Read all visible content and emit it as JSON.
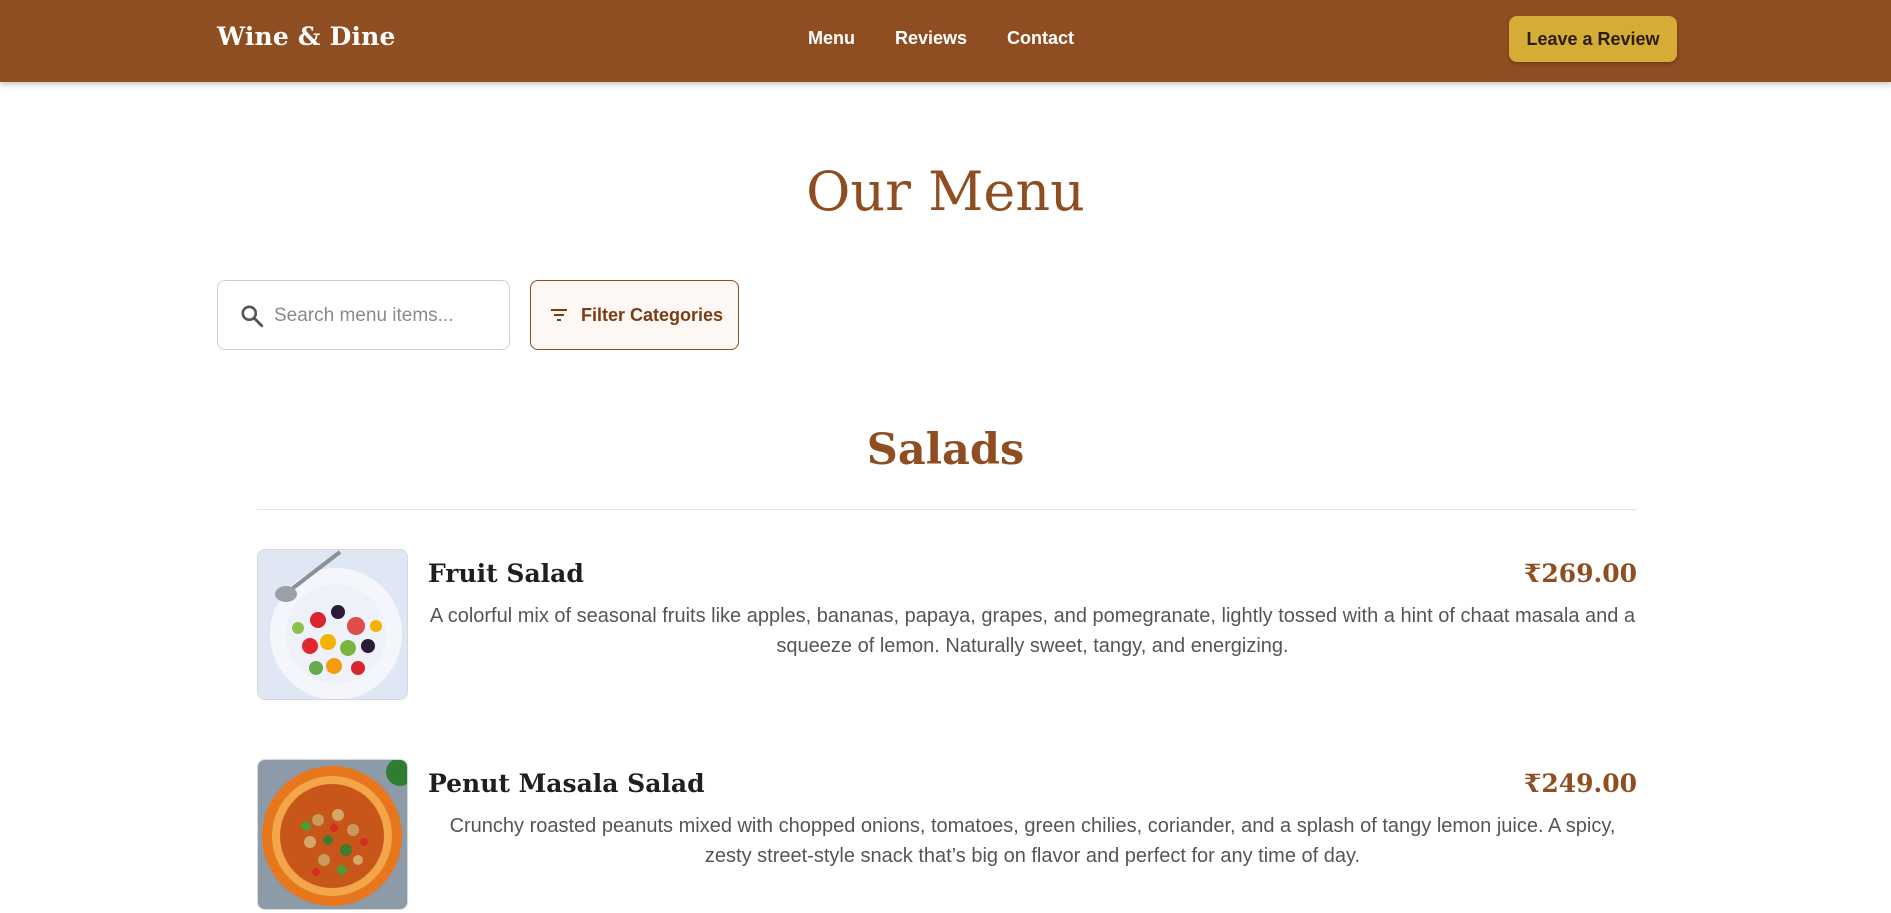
{
  "nav": {
    "brand": "Wine & Dine",
    "links": [
      "Menu",
      "Reviews",
      "Contact"
    ],
    "cta_label": "Leave a Review"
  },
  "main": {
    "title": "Our Menu",
    "search": {
      "placeholder": "Search menu items..."
    },
    "filter_label": "Filter Categories",
    "category": "Salads",
    "items": [
      {
        "name": "Fruit Salad",
        "price": "₹269.00",
        "description": "A colorful mix of seasonal fruits like apples, bananas, papaya, grapes, and pomegranate, lightly tossed with a hint of chaat masala and a squeeze of lemon. Naturally sweet, tangy, and energizing."
      },
      {
        "name": "Penut Masala Salad",
        "price": "₹249.00",
        "description": "Crunchy roasted peanuts mixed with chopped onions, tomatoes, green chilies, coriander, and a splash of tangy lemon juice. A spicy, zesty street-style snack that’s big on flavor and perfect for any time of day."
      }
    ]
  },
  "colors": {
    "brand_brown": "#8f4e21",
    "cta_gold": "#d4ac36"
  }
}
